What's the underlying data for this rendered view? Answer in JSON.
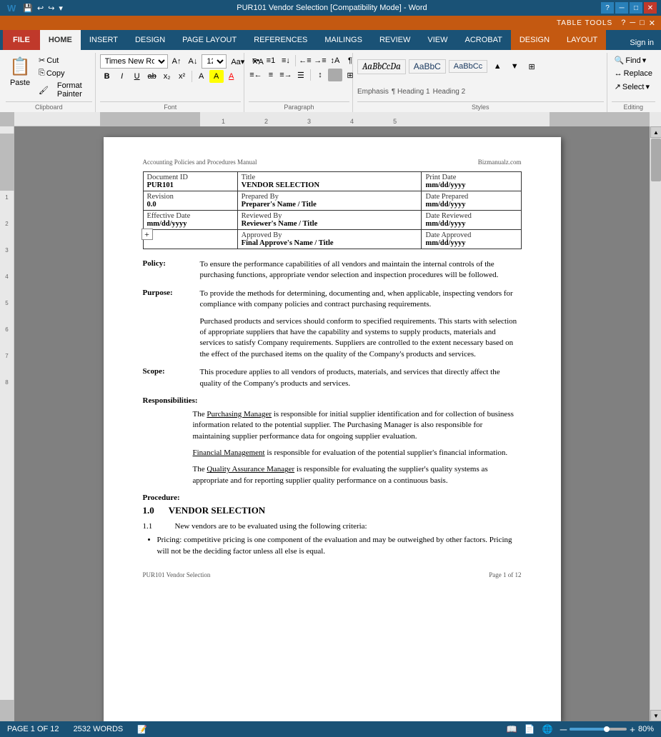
{
  "titlebar": {
    "title": "PUR101 Vendor Selection [Compatibility Mode] - Word",
    "minimize": "─",
    "restore": "□",
    "close": "✕"
  },
  "tabletools": {
    "label": "TABLE TOOLS",
    "helpBtn": "?",
    "ribbon_tabs": [
      "DESIGN",
      "LAYOUT"
    ]
  },
  "tabs": {
    "file": "FILE",
    "home": "HOME",
    "insert": "INSERT",
    "design": "DESIGN",
    "page_layout": "PAGE LAYOUT",
    "references": "REFERENCES",
    "mailings": "MAILINGS",
    "review": "REVIEW",
    "view": "VIEW",
    "acrobat": "ACROBAT",
    "design2": "DESIGN",
    "layout": "LAYOUT",
    "sign_in": "Sign in"
  },
  "ribbon": {
    "paste": "Paste",
    "clipboard_label": "Clipboard",
    "font_name": "Times New Ro",
    "font_size": "12",
    "font_label": "Font",
    "para_label": "Paragraph",
    "styles_label": "Styles",
    "editing_label": "Editing",
    "bold": "B",
    "italic": "I",
    "underline": "U",
    "find": "Find",
    "replace": "Replace",
    "select": "Select",
    "styles": [
      {
        "name": "Emphasis",
        "style": "italic"
      },
      {
        "name": "¶ Heading 1",
        "style": ""
      },
      {
        "name": "AaBbC",
        "style": "heading2"
      }
    ]
  },
  "page": {
    "header_left": "Accounting Policies and Procedures Manual",
    "header_right": "Bizmanualz.com",
    "table": {
      "rows": [
        [
          {
            "label": "Document ID",
            "value": "PUR101"
          },
          {
            "label": "Title",
            "value": "VENDOR SELECTION"
          },
          {
            "label": "Print Date",
            "value": "mm/dd/yyyy"
          }
        ],
        [
          {
            "label": "Revision",
            "value": "0.0"
          },
          {
            "label": "Prepared By",
            "value": "Preparer's Name / Title"
          },
          {
            "label": "Date Prepared",
            "value": "mm/dd/yyyy"
          }
        ],
        [
          {
            "label": "Effective Date",
            "value": "mm/dd/yyyy"
          },
          {
            "label": "Reviewed By",
            "value": "Reviewer's Name / Title"
          },
          {
            "label": "Date Reviewed",
            "value": "mm/dd/yyyy"
          }
        ],
        [
          {
            "label": "",
            "value": ""
          },
          {
            "label": "Approved By",
            "value": "Final Approve's Name / Title"
          },
          {
            "label": "Date Approved",
            "value": "mm/dd/yyyy"
          }
        ]
      ]
    },
    "policy_label": "Policy:",
    "policy_text": "To ensure the performance capabilities of all vendors and maintain the internal controls of the purchasing functions, appropriate vendor selection and inspection procedures will be followed.",
    "purpose_label": "Purpose:",
    "purpose_text": "To provide the methods for determining, documenting and, when applicable, inspecting vendors for compliance with company policies and contract purchasing requirements.",
    "purpose_text2": "Purchased products and services should conform to specified requirements.  This starts with selection of appropriate suppliers that have the capability and systems to supply products, materials and services to satisfy Company requirements.  Suppliers are controlled to the extent necessary based on the effect of the purchased items on the quality of the Company's products and services.",
    "scope_label": "Scope:",
    "scope_text": "This procedure applies to all vendors of products, materials, and services that directly affect the quality of the Company's products and services.",
    "responsibilities_label": "Responsibilities:",
    "resp1_link": "Purchasing Manager",
    "resp1_text": " is responsible for initial supplier identification and for collection of business information related to the potential supplier. The Purchasing Manager is also responsible for maintaining supplier performance data for ongoing supplier evaluation.",
    "resp2_link": "Financial Management",
    "resp2_text": " is responsible for evaluation of the potential supplier's financial information.",
    "resp3_link": "Quality Assurance Manager",
    "resp3_text": " is responsible for evaluating the supplier's quality systems as appropriate and for reporting supplier quality performance on a continuous basis.",
    "procedure_label": "Procedure:",
    "section_num": "1.0",
    "section_title": "VENDOR SELECTION",
    "sub1_num": "1.1",
    "sub1_text": "New vendors are to be evaluated using the following criteria:",
    "bullet1": "Pricing: competitive pricing is one component of the evaluation and may be outweighed by other factors.  Pricing will not be the deciding factor unless all else is equal.",
    "footer_left": "PUR101 Vendor Selection",
    "footer_right": "Page 1 of 12"
  },
  "statusbar": {
    "page_info": "PAGE 1 OF 12",
    "word_count": "2532 WORDS",
    "zoom": "80%"
  }
}
